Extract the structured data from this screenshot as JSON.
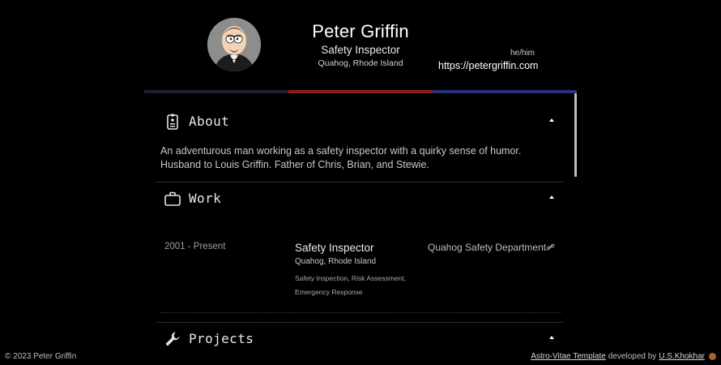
{
  "profile": {
    "name": "Peter Griffin",
    "role": "Safety Inspector",
    "location": "Quahog, Rhode Island",
    "pronouns": "he/him",
    "website": "https://petergriffin.com"
  },
  "colors": {
    "bar": [
      "#1b1f3a",
      "#8a1d1d",
      "#23357a"
    ],
    "background": "#000000"
  },
  "sections": {
    "about": {
      "title": "About",
      "icon": "id-badge-icon",
      "text": "An adventurous man working as a safety inspector with a quirky sense of humor. Husband to Louis Griffin. Father of Chris, Brian, and Stewie."
    },
    "work": {
      "title": "Work",
      "icon": "briefcase-icon",
      "entry": {
        "dates": "2001 - Present",
        "title": "Safety Inspector",
        "location": "Quahog, Rhode Island",
        "tags": "Safety Inspection, Risk Assessment, Emergency Response",
        "company": "Quahog Safety Department"
      }
    },
    "projects": {
      "title": "Projects",
      "icon": "wrench-icon"
    }
  },
  "footer": {
    "copyright": "© 2023 Peter Griffin",
    "template_link": "Astro-Vitae Template",
    "developed_by": "developed by",
    "author_link": "U.S.Khokhar"
  }
}
